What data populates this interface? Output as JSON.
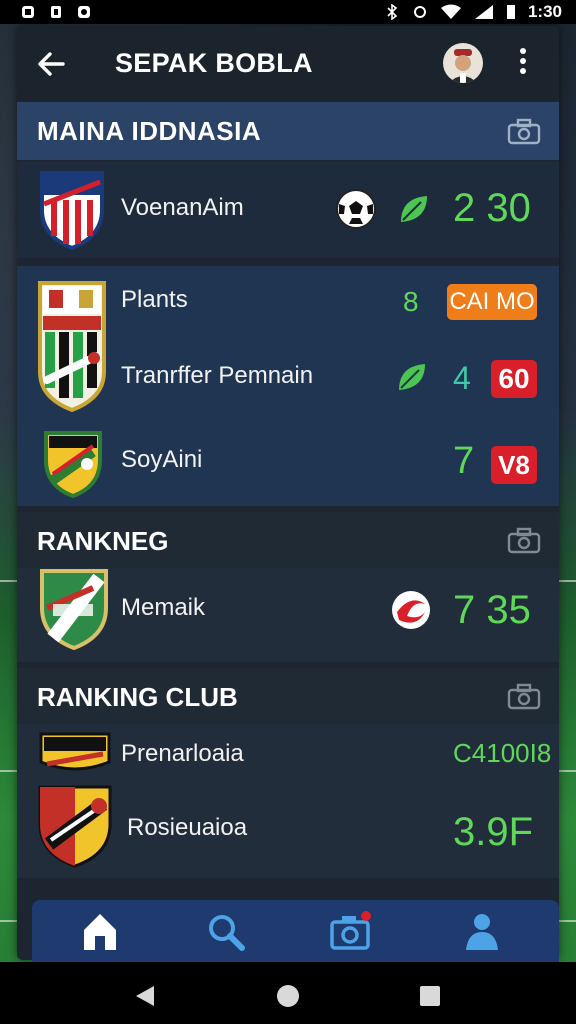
{
  "status_bar": {
    "time": "1:30"
  },
  "app_bar": {
    "title": "SEPAK BOBLA"
  },
  "section_main": {
    "title": "MAINA IDDNASIA",
    "match": {
      "team": "VoenanAim",
      "score": "2 30"
    }
  },
  "card_two": {
    "rows": [
      {
        "name": "Plants",
        "num": "8",
        "badge": "CAI MO",
        "badge_color": "#ef7d1a"
      },
      {
        "name": "Tranrffer  Pemnain",
        "num": "4",
        "badge": "60",
        "badge_color": "#d81f2a"
      },
      {
        "name": "SoyAini",
        "num": "7",
        "badge": "V8",
        "badge_color": "#d81f2a"
      }
    ]
  },
  "section_ranking": {
    "title": "RANKNEG",
    "row": {
      "name": "Memaik",
      "score": "7 35"
    }
  },
  "section_club": {
    "title": "RANKING CLUB",
    "rows": [
      {
        "name": "Prenarloaia",
        "value": "C4100I8"
      },
      {
        "name": "Rosieuaioa",
        "value": "3.9F"
      }
    ]
  },
  "bottom_nav": {
    "items": [
      "home-icon",
      "search-icon",
      "camera-icon",
      "profile-icon"
    ],
    "partial_label": "RANKING CLUB"
  },
  "colors": {
    "accent_green": "#5fd85a",
    "panel": "#1c2530",
    "nav": "#1e3a6e"
  }
}
